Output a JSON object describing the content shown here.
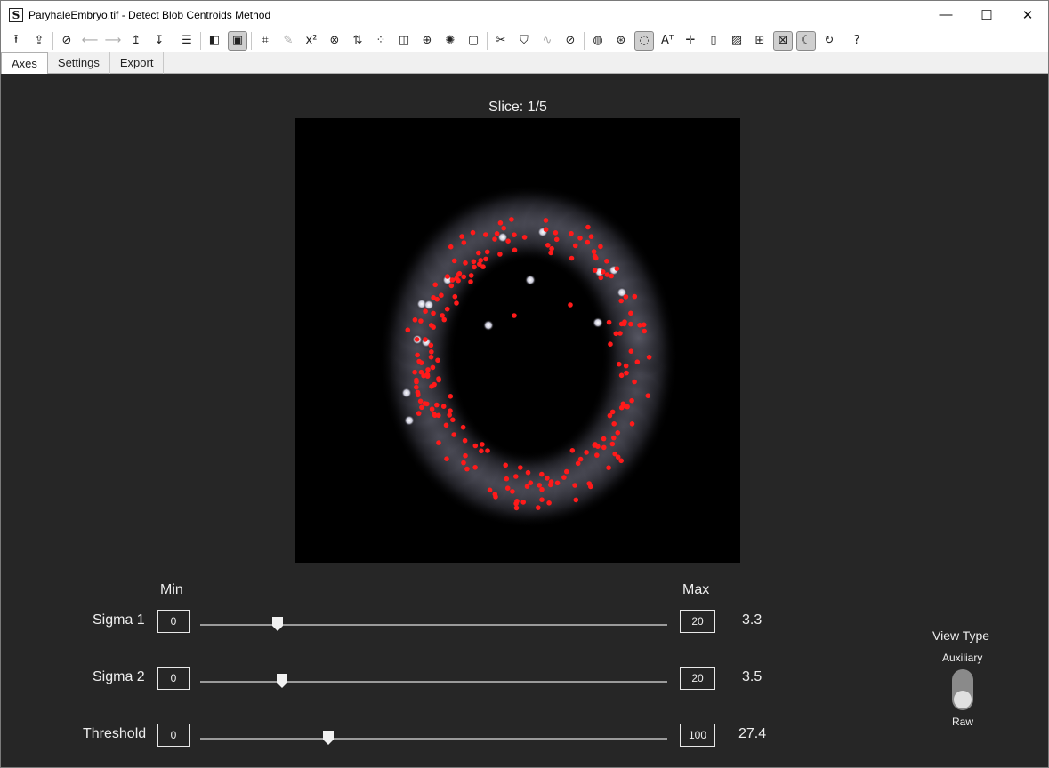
{
  "window": {
    "app_icon_letter": "S",
    "title": "ParyhaleEmbryo.tif - Detect Blob Centroids Method",
    "controls": {
      "minimize": "—",
      "maximize": "☐",
      "close": "✕"
    }
  },
  "toolbar": {
    "icons": [
      {
        "name": "upload-icon",
        "glyph": "⭱"
      },
      {
        "name": "export-image-icon",
        "glyph": "⇪"
      },
      {
        "name": "compass-icon",
        "glyph": "⊘"
      },
      {
        "name": "arrow-left-icon",
        "glyph": "⟵"
      },
      {
        "name": "arrow-right-icon",
        "glyph": "⟶"
      },
      {
        "name": "arrow-up-icon",
        "glyph": "↥"
      },
      {
        "name": "arrow-down-icon",
        "glyph": "↧"
      },
      {
        "name": "layers-icon",
        "glyph": "☰"
      },
      {
        "name": "contrast-icon",
        "glyph": "◧"
      },
      {
        "name": "window-settings-icon",
        "glyph": "▣"
      },
      {
        "name": "crop-icon",
        "glyph": "⌗"
      },
      {
        "name": "pen-icon",
        "glyph": "✎"
      },
      {
        "name": "superscript-icon",
        "glyph": "x²"
      },
      {
        "name": "bandage-icon",
        "glyph": "⊗"
      },
      {
        "name": "sort-icon",
        "glyph": "⇅"
      },
      {
        "name": "dots-grid-icon",
        "glyph": "⁘"
      },
      {
        "name": "split-icon",
        "glyph": "◫"
      },
      {
        "name": "search-target-icon",
        "glyph": "⊕"
      },
      {
        "name": "magic-icon",
        "glyph": "✺"
      },
      {
        "name": "chip-icon",
        "glyph": "▢"
      },
      {
        "name": "tools-icon",
        "glyph": "✂"
      },
      {
        "name": "shield-icon",
        "glyph": "⛉"
      },
      {
        "name": "pulse-icon",
        "glyph": "∿"
      },
      {
        "name": "slash-box-icon",
        "glyph": "⊘"
      },
      {
        "name": "palette-icon",
        "glyph": "◍"
      },
      {
        "name": "color-circles-icon",
        "glyph": "⊛"
      },
      {
        "name": "blob-detect-icon",
        "glyph": "◌"
      },
      {
        "name": "text-size-icon",
        "glyph": "Aᵀ"
      },
      {
        "name": "crosshair-icon",
        "glyph": "✛"
      },
      {
        "name": "colorbar-icon",
        "glyph": "▯"
      },
      {
        "name": "image-icon",
        "glyph": "▨"
      },
      {
        "name": "tile-grid-icon",
        "glyph": "⊞"
      },
      {
        "name": "close-box-icon",
        "glyph": "⊠"
      },
      {
        "name": "dark-mode-icon",
        "glyph": "☾"
      },
      {
        "name": "refresh-icon",
        "glyph": "↻"
      },
      {
        "name": "help-icon",
        "glyph": "?"
      }
    ]
  },
  "tabs": [
    {
      "label": "Axes",
      "active": true
    },
    {
      "label": "Settings",
      "active": false
    },
    {
      "label": "Export",
      "active": false
    }
  ],
  "image": {
    "slice_title": "Slice: 1/5",
    "centroid_color": "#ff1a1a",
    "background": "#000000"
  },
  "sliders": {
    "min_header": "Min",
    "max_header": "Max",
    "rows": [
      {
        "label": "Sigma 1",
        "min": "0",
        "max": "20",
        "value": "3.3",
        "fraction": 0.165
      },
      {
        "label": "Sigma 2",
        "min": "0",
        "max": "20",
        "value": "3.5",
        "fraction": 0.175
      },
      {
        "label": "Threshold",
        "min": "0",
        "max": "100",
        "value": "27.4",
        "fraction": 0.274
      }
    ]
  },
  "view_type": {
    "title": "View Type",
    "top_option": "Auxiliary",
    "bottom_option": "Raw",
    "selected": "Raw"
  }
}
